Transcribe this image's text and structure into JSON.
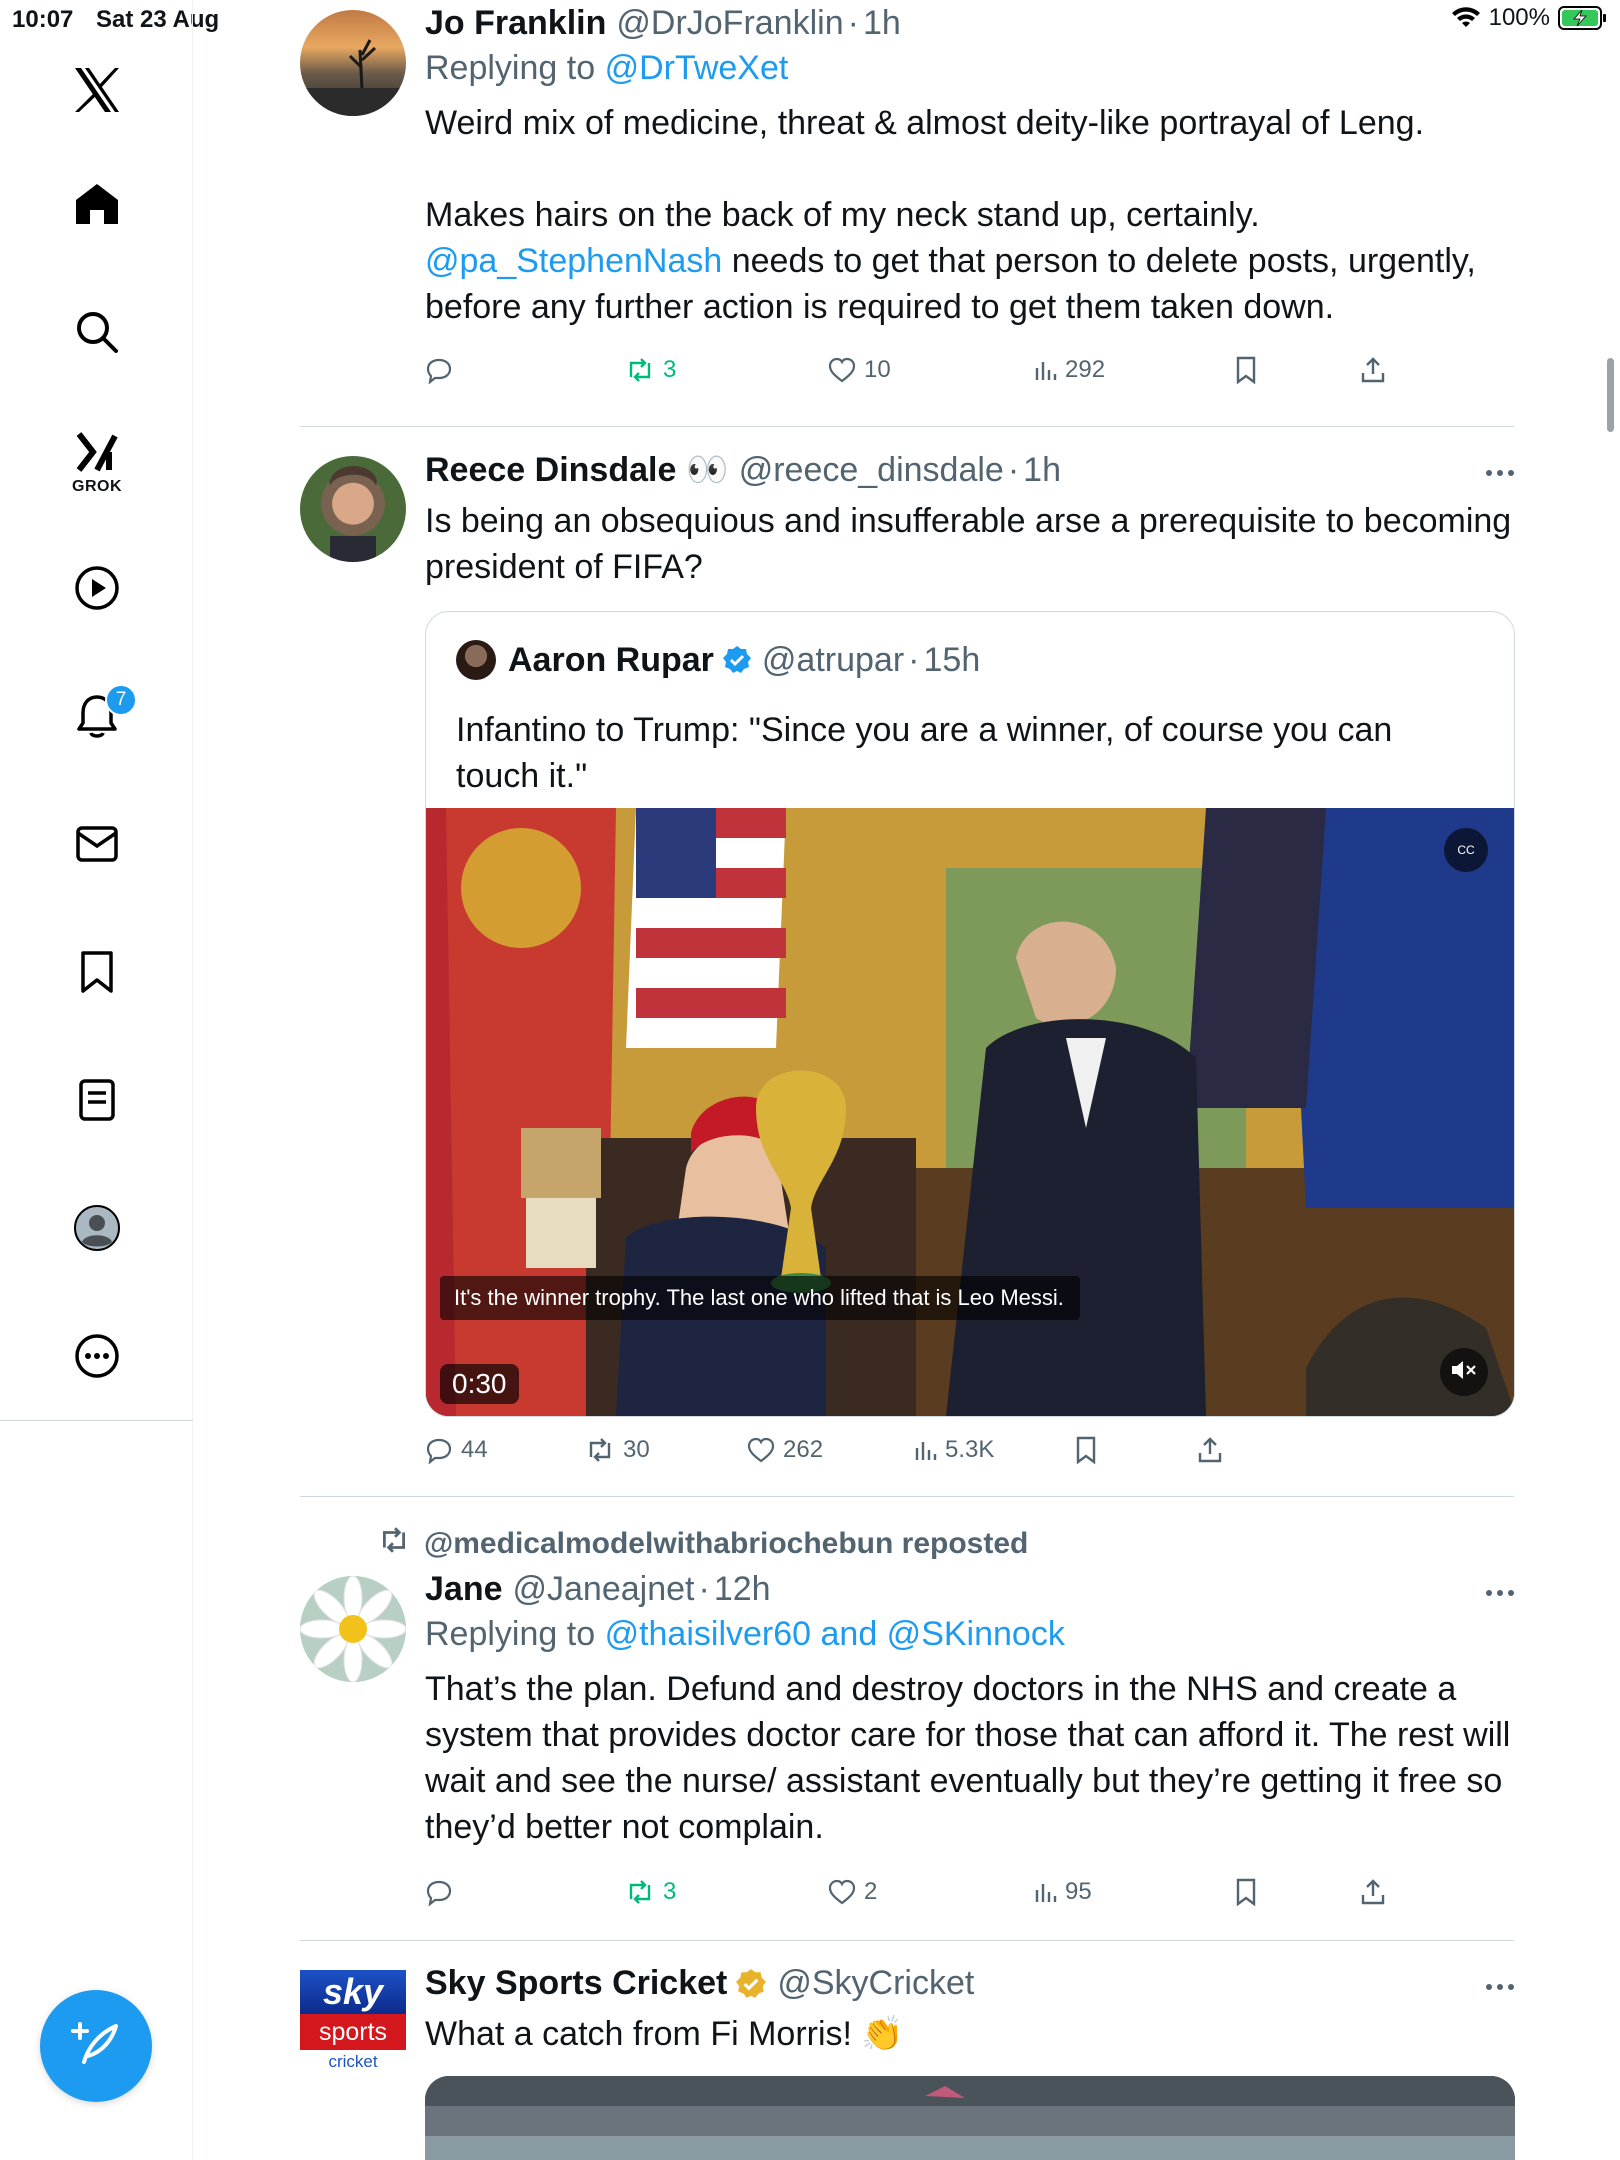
{
  "status_bar": {
    "time": "10:07",
    "date": "Sat 23 Aug",
    "battery": "100%"
  },
  "sidebar": {
    "items": [
      {
        "name": "home",
        "icon": "home-icon"
      },
      {
        "name": "explore",
        "icon": "search-icon"
      },
      {
        "name": "grok",
        "icon": "grok-icon",
        "label": "GROK"
      },
      {
        "name": "videos",
        "icon": "play-icon"
      },
      {
        "name": "notifications",
        "icon": "bell-icon",
        "badge": "7"
      },
      {
        "name": "messages",
        "icon": "mail-icon"
      },
      {
        "name": "bookmarks",
        "icon": "bookmark-icon"
      },
      {
        "name": "lists",
        "icon": "list-icon"
      },
      {
        "name": "profile",
        "icon": "profile-icon"
      },
      {
        "name": "more",
        "icon": "more-circle-icon"
      }
    ],
    "compose_icon": "compose-icon"
  },
  "tweets": [
    {
      "author": "Jo Franklin",
      "handle": "@DrJoFranklin",
      "time": "1h",
      "reply_prefix": "Replying to",
      "reply_to": "@DrTweXet",
      "text_1": "Weird mix of medicine, threat & almost deity-like portrayal of Leng.",
      "text_2": "Makes hairs on the back of my neck stand up, certainly.",
      "mention": "@pa_StephenNash",
      "text_3": " needs to get that person to delete posts, urgently, before any further action is required to get them taken down.",
      "stats": {
        "replies": "",
        "reposts": "3",
        "likes": "10",
        "views": "292"
      }
    },
    {
      "author": "Reece Dinsdale",
      "emoji": "👀",
      "handle": "@reece_dinsdale",
      "time": "1h",
      "text": "Is being an obsequious and insufferable arse a prerequisite to becoming president of FIFA?",
      "quote": {
        "author": "Aaron Rupar",
        "handle": "@atrupar",
        "time": "15h",
        "text": "Infantino to Trump: \"Since you are a winner, of course you can touch it.\"",
        "video_caption": "It's the winner trophy. The last one who lifted that is Leo Messi.",
        "video_duration": "0:30",
        "cc_label": "CC"
      },
      "stats": {
        "replies": "44",
        "reposts": "30",
        "likes": "262",
        "views": "5.3K"
      }
    },
    {
      "repost_by": "@medicalmodelwithabriochebun reposted",
      "author": "Jane",
      "handle": "@Janeajnet",
      "time": "12h",
      "reply_prefix": "Replying to",
      "reply_to": "@thaisilver60 and @SKinnock",
      "text": "That’s the plan. Defund and destroy doctors in the NHS and create a system that provides doctor care for those that can afford it. The rest will wait and see the nurse/ assistant eventually but they’re getting it free so they’d better not complain.",
      "stats": {
        "replies": "",
        "reposts": "3",
        "likes": "2",
        "views": "95"
      }
    },
    {
      "author": "Sky Sports Cricket",
      "handle": "@SkyCricket",
      "text": "What a catch from Fi Morris! 👏",
      "logo": {
        "top": "sky",
        "middle": "sports",
        "bottom": "cricket"
      }
    }
  ],
  "colors": {
    "accent": "#1d9bf0",
    "repost_green": "#00ba7c",
    "muted": "#536471",
    "verified_gold": "#e8b32a"
  }
}
